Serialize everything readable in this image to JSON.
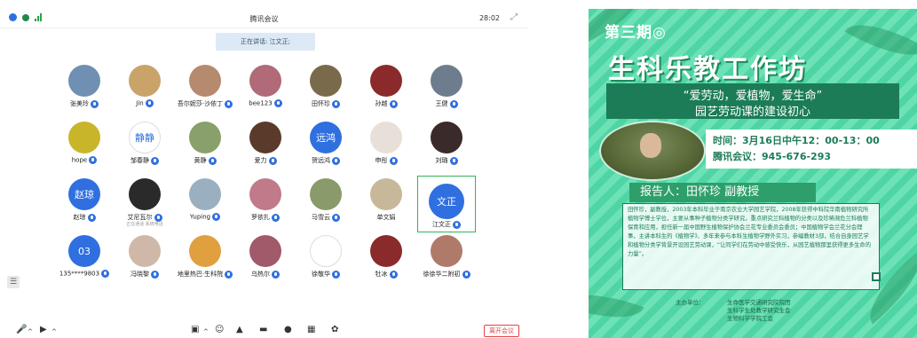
{
  "meeting": {
    "window_title": "腾讯会议",
    "time": "28:02",
    "speaking_label": "正在讲话: 江文正;",
    "participants": [
      {
        "name": "张美玲",
        "avatar_text": "",
        "color": "#6f8fb3",
        "mic": true
      },
      {
        "name": "Jin",
        "avatar_text": "",
        "color": "#c9a36a",
        "mic": true
      },
      {
        "name": "吾尔妮莎·沙依丁",
        "avatar_text": "",
        "color": "#b58a6e",
        "mic": true
      },
      {
        "name": "bee123",
        "avatar_text": "",
        "color": "#b06a78",
        "mic": true
      },
      {
        "name": "田怀珍",
        "avatar_text": "",
        "color": "#7a6a4c",
        "mic": true
      },
      {
        "name": "孙越",
        "avatar_text": "",
        "color": "#8a2a2a",
        "mic": true
      },
      {
        "name": "王健",
        "avatar_text": "",
        "color": "#6d7d8d",
        "mic": true
      },
      {
        "name": "hope",
        "avatar_text": "",
        "color": "#c9b52a",
        "mic": true
      },
      {
        "name": "邹春静",
        "avatar_text": "静静",
        "color": "#ffffff",
        "mic": true
      },
      {
        "name": "黄静",
        "avatar_text": "",
        "color": "#8aa06a",
        "mic": true
      },
      {
        "name": "爱力",
        "avatar_text": "",
        "color": "#5a3a2a",
        "mic": true
      },
      {
        "name": "贺远鸿",
        "avatar_text": "远鸿",
        "color": "#2f6fe0",
        "mic": true
      },
      {
        "name": "申彤",
        "avatar_text": "",
        "color": "#e8e0d8",
        "mic": true
      },
      {
        "name": "刘璐",
        "avatar_text": "",
        "color": "#3a2a2a",
        "mic": true
      },
      {
        "name": "赵琼",
        "avatar_text": "赵琼",
        "color": "#2f6fe0",
        "mic": true
      },
      {
        "name": "艾尼瓦尔",
        "avatar_text": "",
        "color": "#2a2a2a",
        "mic": true,
        "note": "正在通话 系统电话"
      },
      {
        "name": "Yuping",
        "avatar_text": "",
        "color": "#9ab0c0",
        "mic": true
      },
      {
        "name": "罗依扎",
        "avatar_text": "",
        "color": "#c07a8a",
        "mic": true
      },
      {
        "name": "马雪云",
        "avatar_text": "",
        "color": "#8a9a6a",
        "mic": true
      },
      {
        "name": "单文娟",
        "avatar_text": "",
        "color": "#c8b89a",
        "mic": false
      },
      {
        "name": "江文正",
        "avatar_text": "文正",
        "color": "#2f6fe0",
        "mic": true,
        "selected": true
      },
      {
        "name": "135****9803",
        "avatar_text": "03",
        "color": "#2f6fe0",
        "mic": true
      },
      {
        "name": "冯晓黎",
        "avatar_text": "",
        "color": "#d0b8a8",
        "mic": true
      },
      {
        "name": "地里热巴·生科院",
        "avatar_text": "",
        "color": "#e0a040",
        "mic": true
      },
      {
        "name": "乌热尔",
        "avatar_text": "",
        "color": "#a05a6a",
        "mic": true
      },
      {
        "name": "徐敬华",
        "avatar_text": "",
        "color": "#ffffff",
        "mic": true
      },
      {
        "name": "牡冰",
        "avatar_text": "",
        "color": "#8a2a2a",
        "mic": true
      },
      {
        "name": "徐徐华二附初",
        "avatar_text": "",
        "color": "#b07a6a",
        "mic": true
      }
    ],
    "leave_label": "离开会议"
  },
  "poster": {
    "issue": "第三期◎",
    "title": "生科乐教工作坊",
    "sub1": "“爱劳动，爱植物，爱生命”",
    "sub2": "园艺劳动课的建设初心",
    "time": "时间：3月16日中午12：00-13：00",
    "room": "腾讯会议：945-676-293",
    "speaker": "报告人：田怀珍 副教授",
    "bio": "田怀珍，副教授，2003年本科毕业于南京农业大学园艺学院，2008年获得中科院华南植物研究所植物学博士学位，主要从事种子植物分类学研究，重点研究兰科植物的分类以及珍稀濒危兰科植物保育和应用，担任新一届中国野生植物保护协会兰花专业委员会委员；中国植物学会兰花分会理事，主讲本科生的《植物学》、多年来参与本科生植物学野外实习，参编教材3部，结合自身园艺学和植物分类学背景开设园艺劳动课，“让同学们在劳动中感受快乐，从园艺植物那里获得更多生命的力量”。",
    "org_label": "主办单位：",
    "org_lines": [
      "生命医学交通研究院院团",
      "生科学生处教学研究生会",
      "生物科学学院工会"
    ]
  }
}
